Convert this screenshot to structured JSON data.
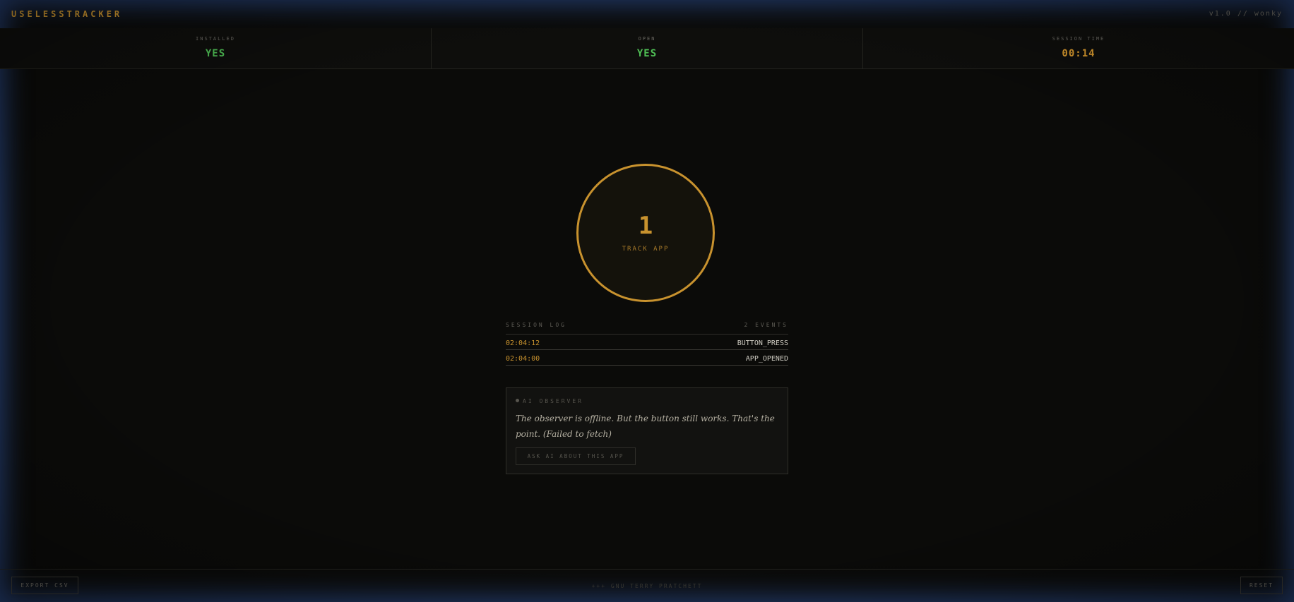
{
  "header": {
    "brand": "USELESSTRACKER",
    "version": "v1.0 // wonky"
  },
  "stats": [
    {
      "label": "INSTALLED",
      "value": "YES",
      "color": "#4fbf55"
    },
    {
      "label": "OPEN",
      "value": "YES",
      "color": "#4fbf55"
    },
    {
      "label": "SESSION TIME",
      "value": "00:14",
      "color": "#d99a2e"
    }
  ],
  "track_button": {
    "count": "1",
    "label": "TRACK APP",
    "accent": "#c8922e"
  },
  "session_log": {
    "title": "SESSION LOG",
    "count_label": "2 EVENTS",
    "entries": [
      {
        "time": "02:04:12",
        "event": "BUTTON_PRESS"
      },
      {
        "time": "02:04:00",
        "event": "APP_OPENED"
      }
    ]
  },
  "observer": {
    "title": "AI OBSERVER",
    "message": "The observer is offline. But the button still works. That's the point. (Failed to fetch)",
    "button_label": "ASK AI ABOUT THIS APP"
  },
  "footer": {
    "export_label": "EXPORT CSV",
    "note": "+++ GNU TERRY PRATCHETT",
    "reset_label": "RESET"
  }
}
